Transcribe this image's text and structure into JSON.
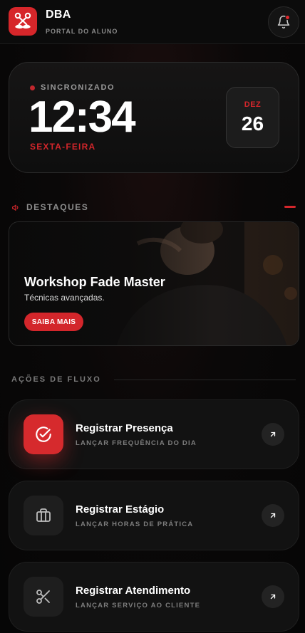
{
  "header": {
    "brand_title": "DBA",
    "brand_subtitle": "PORTAL DO ALUNO",
    "logo_icon": "scissors-mustache-icon",
    "notification_icon": "bell-icon",
    "has_unread": true
  },
  "clock": {
    "status": "SINCRONIZADO",
    "time": "12:34",
    "weekday": "SEXTA-FEIRA",
    "month": "DEZ",
    "day": "26"
  },
  "highlights": {
    "section_label": "DESTAQUES",
    "section_icon": "megaphone-icon",
    "card": {
      "title": "Workshop Fade Master",
      "subtitle": "Técnicas avançadas.",
      "button_label": "SAIBA MAIS"
    }
  },
  "actions": {
    "section_label": "AÇÕES DE FLUXO",
    "items": [
      {
        "title": "Registrar Presença",
        "subtitle": "LANÇAR FREQUÊNCIA DO DIA",
        "icon": "check-circle-icon"
      },
      {
        "title": "Registrar Estágio",
        "subtitle": "LANÇAR HORAS DE PRÁTICA",
        "icon": "briefcase-icon"
      },
      {
        "title": "Registrar Atendimento",
        "subtitle": "LANÇAR SERVIÇO AO CLIENTE",
        "icon": "scissors-icon"
      }
    ]
  },
  "colors": {
    "accent": "#d3262b",
    "background": "#0a0808",
    "card": "#121212"
  }
}
